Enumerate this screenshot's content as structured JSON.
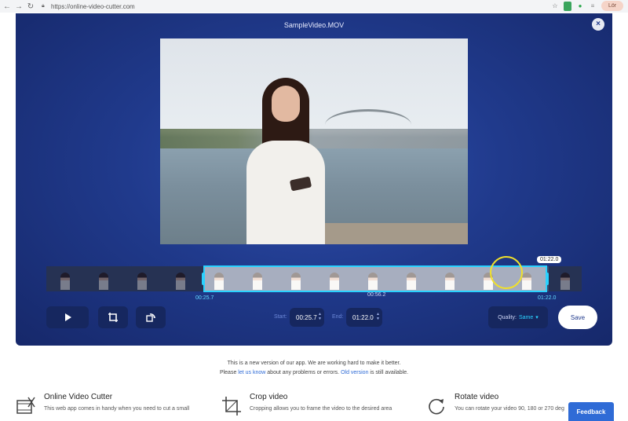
{
  "browser": {
    "url": "https://online-video-cutter.com",
    "avatar_text": "Lör"
  },
  "editor": {
    "file_title": "SampleVideo.MOV",
    "close_label": "×",
    "timeline": {
      "start_time_label": "00:25.7",
      "mid_time_label": "00:56.2",
      "end_time_label": "01:22.0",
      "end_bubble": "01:22.0"
    },
    "controls": {
      "start_label": "Start:",
      "start_value": "00:25.7",
      "end_label": "End:",
      "end_value": "01:22.0",
      "quality_label": "Quality:",
      "quality_value": "Same",
      "save_label": "Save"
    }
  },
  "notice": {
    "line1": "This is a new version of our app. We are working hard to make it better.",
    "line2_pre": "Please",
    "line2_link1": "let us know",
    "line2_mid": "about any problems or errors.",
    "line2_link2": "Old version",
    "line2_post": "is still available."
  },
  "features": [
    {
      "icon": "film-cut-icon",
      "title": "Online Video Cutter",
      "desc": "This web app comes in handy when you need to cut a small"
    },
    {
      "icon": "crop-icon",
      "title": "Crop video",
      "desc": "Cropping allows you to frame the video to the desired area"
    },
    {
      "icon": "rotate-icon",
      "title": "Rotate video",
      "desc": "You can rotate your video 90, 180 or 270 deg"
    }
  ],
  "feedback_label": "Feedback",
  "colors": {
    "editor_bg": "#203a8c",
    "accent": "#2bd2ff",
    "link": "#2f6bd6"
  }
}
